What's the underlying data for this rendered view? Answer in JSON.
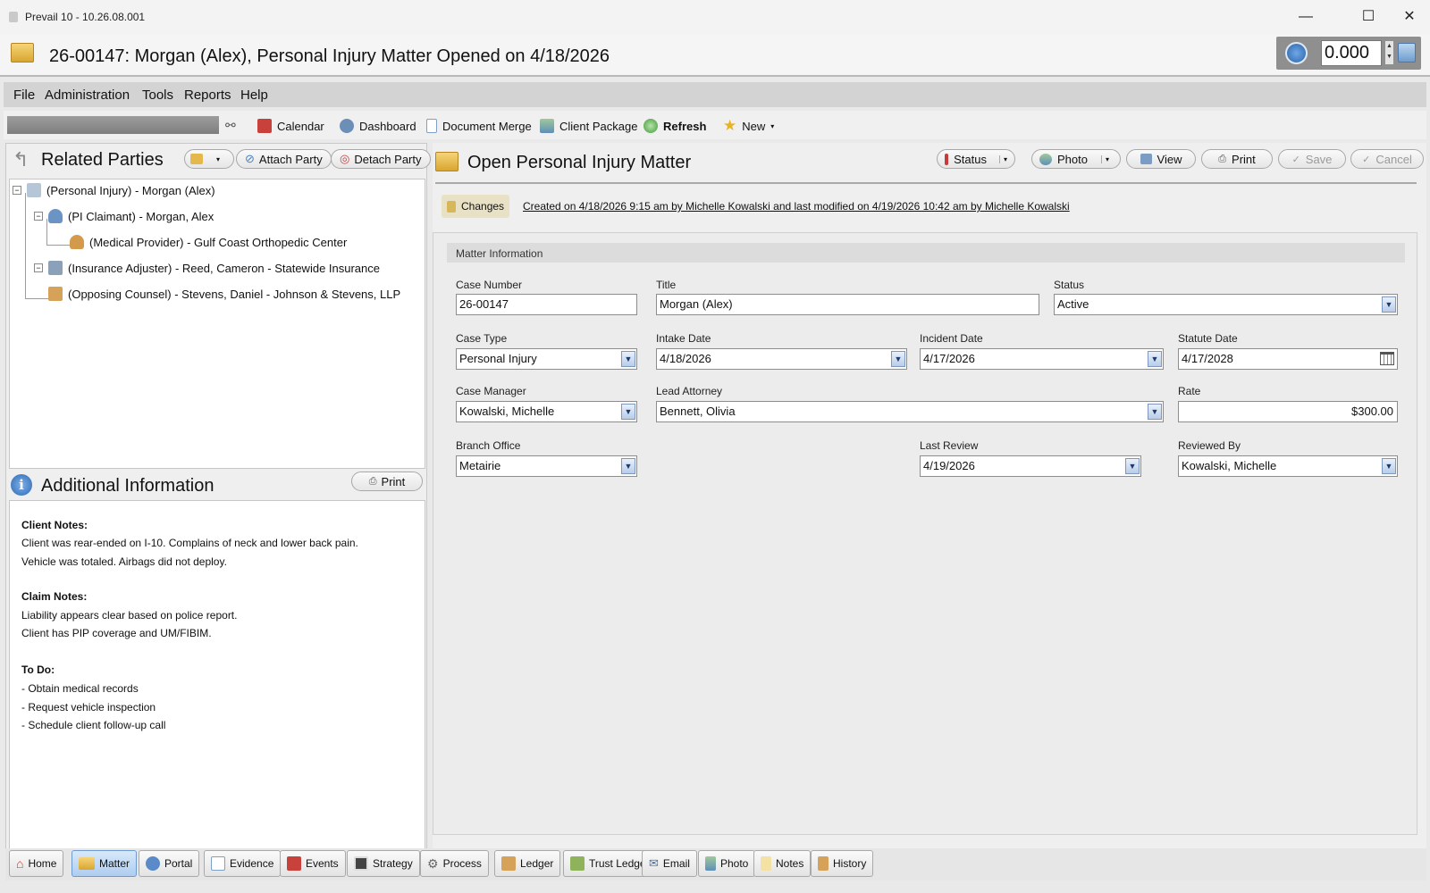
{
  "window": {
    "title": "Prevail 10 - 10.26.08.001",
    "minimize": "—",
    "maximize": "☐",
    "close": "✕"
  },
  "header": {
    "heading": "26-00147: Morgan (Alex), Personal Injury Matter Opened on 4/18/2026",
    "timer_value": "0.000"
  },
  "menu": [
    "File",
    "Administration",
    "Tools",
    "Reports",
    "Help"
  ],
  "toolbar": {
    "calendar": "Calendar",
    "dashboard": "Dashboard",
    "document_merge": "Document Merge",
    "client_package": "Client Package",
    "refresh": "Refresh",
    "new": "New"
  },
  "related_parties": {
    "title": "Related Parties",
    "attach": "Attach Party",
    "detach": "Detach Party",
    "items": [
      "(Personal Injury) - Morgan (Alex)",
      "(PI Claimant) - Morgan, Alex",
      "(Medical Provider) - Gulf Coast Orthopedic Center",
      "(Insurance Adjuster) - Reed, Cameron - Statewide Insurance",
      "(Opposing Counsel) - Stevens, Daniel - Johnson & Stevens, LLP"
    ]
  },
  "additional_info": {
    "title": "Additional Information",
    "print": "Print",
    "client_notes_heading": "Client Notes:",
    "client_notes": [
      "Client was rear-ended on I-10. Complains of neck and lower back pain.",
      "Vehicle was totaled.  Airbags did not deploy."
    ],
    "claim_notes_heading": "Claim Notes:",
    "claim_notes": [
      "Liability appears clear based on police report.",
      "Client has PIP coverage and UM/FIBIM."
    ],
    "todo_heading": "To Do:",
    "todo": [
      "- Obtain medical records",
      "- Request vehicle inspection",
      "- Schedule client follow-up call"
    ]
  },
  "matter": {
    "title": "Open Personal Injury Matter",
    "actions": {
      "status": "Status",
      "photo": "Photo",
      "view": "View",
      "print": "Print",
      "save": "Save",
      "cancel": "Cancel"
    },
    "changes": "Changes",
    "created_info": "Created on 4/18/2026 9:15 am by Michelle Kowalski and last modified on 4/19/2026 10:42 am by Michelle Kowalski",
    "section": "Matter Information",
    "fields": {
      "case_number": {
        "label": "Case Number",
        "value": "26-00147"
      },
      "title": {
        "label": "Title",
        "value": "Morgan (Alex)"
      },
      "status": {
        "label": "Status",
        "value": "Active"
      },
      "case_type": {
        "label": "Case Type",
        "value": "Personal Injury"
      },
      "intake_date": {
        "label": "Intake Date",
        "value": "4/18/2026"
      },
      "incident_date": {
        "label": "Incident Date",
        "value": "4/17/2026"
      },
      "statute_date": {
        "label": "Statute Date",
        "value": "4/17/2028"
      },
      "case_manager": {
        "label": "Case Manager",
        "value": "Kowalski, Michelle"
      },
      "lead_attorney": {
        "label": "Lead Attorney",
        "value": "Bennett, Olivia"
      },
      "rate": {
        "label": "Rate",
        "value": "$300.00"
      },
      "branch_office": {
        "label": "Branch Office",
        "value": "Metairie"
      },
      "last_review": {
        "label": "Last Review",
        "value": "4/19/2026"
      },
      "reviewed_by": {
        "label": "Reviewed By",
        "value": "Kowalski,  Michelle"
      }
    }
  },
  "bottom_tabs": [
    "Home",
    "Matter",
    "Portal",
    "Evidence",
    "Events",
    "Strategy",
    "Process",
    "Ledger",
    "Trust Ledger",
    "Email",
    "Photo",
    "Notes",
    "History"
  ],
  "active_tab": "Matter",
  "colors": {
    "accent": "#6d9bd0",
    "dropdown_arrow": "#b9cde8"
  }
}
